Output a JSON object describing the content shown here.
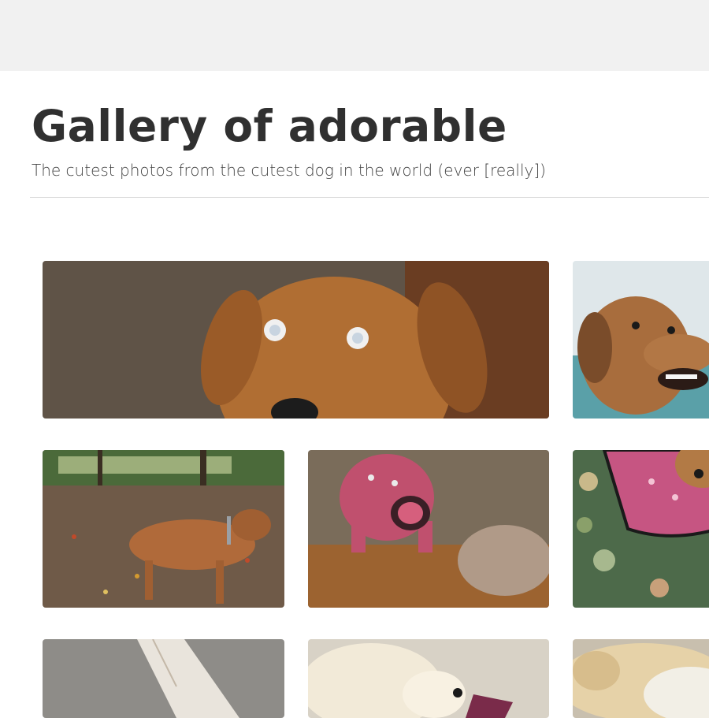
{
  "gallery": {
    "title": "Gallery of adorable",
    "subtitle": "The cutest photos from the cutest dog in the world (ever [really])"
  },
  "photos": [
    {
      "name": "photo-dog-closeup",
      "depicts": "brown hound face close-up"
    },
    {
      "name": "photo-dog-smiling-outdoors",
      "depicts": "brown hound smiling"
    },
    {
      "name": "photo-dog-autumn-leaves",
      "depicts": "hound walking in fallen leaves"
    },
    {
      "name": "photo-pink-pig-toy",
      "depicts": "pink pig plush on dog"
    },
    {
      "name": "photo-dog-pink-vest",
      "depicts": "dog in pink floral vest"
    },
    {
      "name": "photo-white-pillow",
      "depicts": "white pillow on carpet"
    },
    {
      "name": "photo-white-dog-toy",
      "depicts": "white dog with toy"
    },
    {
      "name": "photo-yellow-lab-sleeping",
      "depicts": "yellow lab lying down"
    }
  ]
}
